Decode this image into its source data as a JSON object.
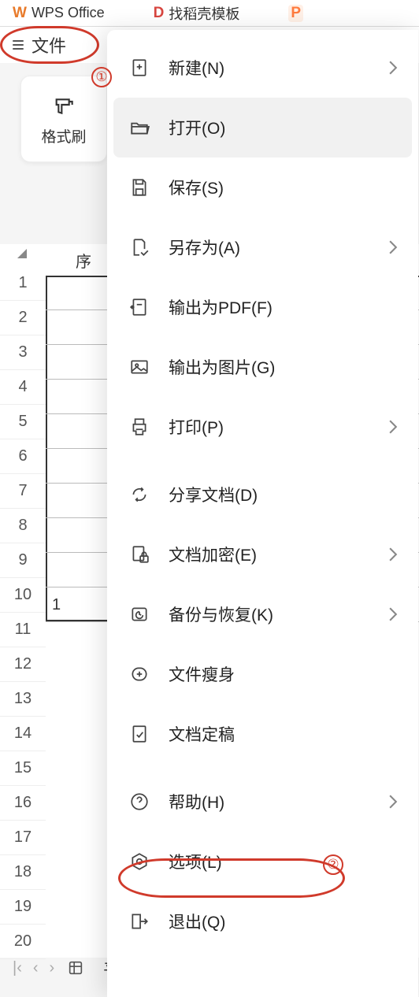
{
  "tabs": {
    "wps": "WPS Office",
    "docer": "找稻壳模板",
    "ppt": ""
  },
  "file_button": "文件",
  "format_paint": "格式刷",
  "column_header": "序",
  "row_numbers": [
    "1",
    "2",
    "3",
    "4",
    "5",
    "6",
    "7",
    "8",
    "9",
    "10",
    "11",
    "12",
    "13",
    "14",
    "15",
    "16",
    "17",
    "18",
    "19",
    "20"
  ],
  "cell_a11": "1",
  "sheet_tab": "平…",
  "menu": {
    "new": "新建(N)",
    "open": "打开(O)",
    "save": "保存(S)",
    "saveas": "另存为(A)",
    "pdf": "输出为PDF(F)",
    "image": "输出为图片(G)",
    "print": "打印(P)",
    "share": "分享文档(D)",
    "encrypt": "文档加密(E)",
    "backup": "备份与恢复(K)",
    "slim": "文件瘦身",
    "final": "文档定稿",
    "help": "帮助(H)",
    "options": "选项(L)",
    "exit": "退出(Q)"
  },
  "annot": {
    "one": "①",
    "two": "②"
  }
}
